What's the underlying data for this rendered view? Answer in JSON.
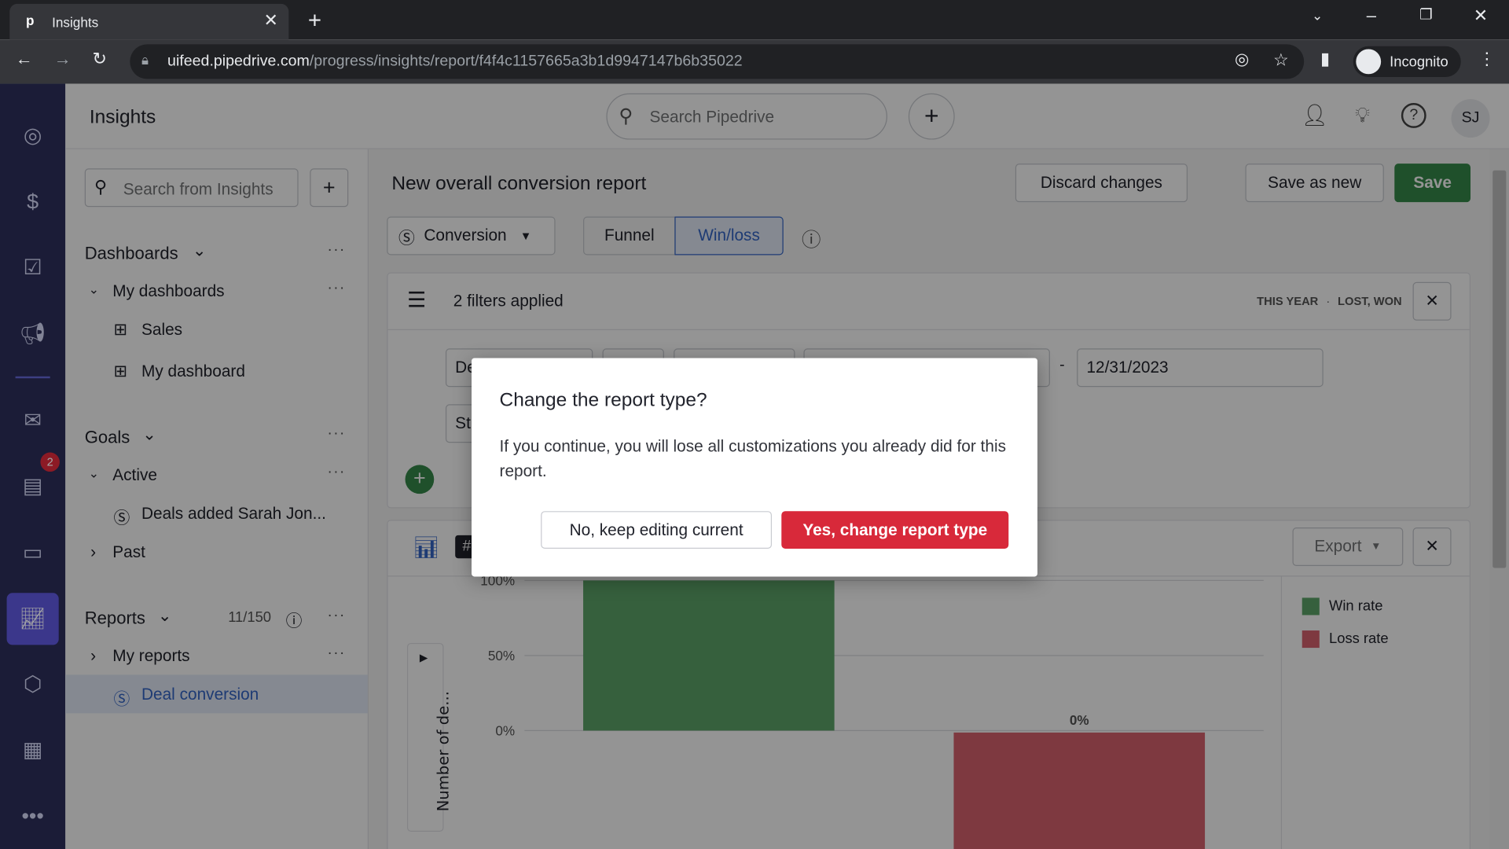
{
  "browser": {
    "tab_title": "Insights",
    "url_domain": "uifeed.pipedrive.com",
    "url_path": "/progress/insights/report/f4f4c1157665a3b1d9947147b6b35022",
    "profile_label": "Incognito"
  },
  "header": {
    "title": "Insights",
    "search_placeholder": "Search Pipedrive",
    "avatar_initials": "SJ"
  },
  "rail": {
    "badge_count": "2"
  },
  "sidebar": {
    "search_placeholder": "Search from Insights",
    "dashboards_label": "Dashboards",
    "my_dashboards_label": "My dashboards",
    "dashboards": [
      "Sales",
      "My dashboard"
    ],
    "goals_label": "Goals",
    "active_label": "Active",
    "goal_item": "Deals added Sarah Jon...",
    "past_label": "Past",
    "reports_label": "Reports",
    "reports_count": "11/150",
    "my_reports_label": "My reports",
    "active_report": "Deal conversion"
  },
  "report": {
    "title": "New overall conversion report",
    "discard_label": "Discard changes",
    "save_as_new_label": "Save as new",
    "save_label": "Save",
    "type_select": "Conversion",
    "view_tabs": [
      "Funnel",
      "Win/loss"
    ],
    "active_view": "Win/loss",
    "filters_label": "2 filters applied",
    "filter_summary_period": "THIS YEAR",
    "filter_summary_status": "LOST, WON",
    "filter_field_1": "De",
    "filter_field_2": "St",
    "date_separator": "-",
    "end_date": "12/31/2023",
    "export_label": "Export",
    "hash_label": "#"
  },
  "modal": {
    "title": "Change the report type?",
    "body": "If you continue, you will lose all customizations you already did for this report.",
    "cancel_label": "No, keep editing current",
    "confirm_label": "Yes, change report type"
  },
  "colors": {
    "win": "#5ea66a",
    "loss": "#d9636f",
    "save": "#368a4a",
    "confirm": "#d8293a",
    "rail": "#2a2c55"
  },
  "chart_data": {
    "type": "bar",
    "ylabel": "Number of de...",
    "yticks": [
      "0%",
      "50%",
      "100%"
    ],
    "ylim": [
      0,
      100
    ],
    "series": [
      {
        "name": "Win rate",
        "value": 100,
        "label": "100%"
      },
      {
        "name": "Loss rate",
        "value": 0,
        "label": "0%"
      }
    ],
    "legend": "right"
  }
}
